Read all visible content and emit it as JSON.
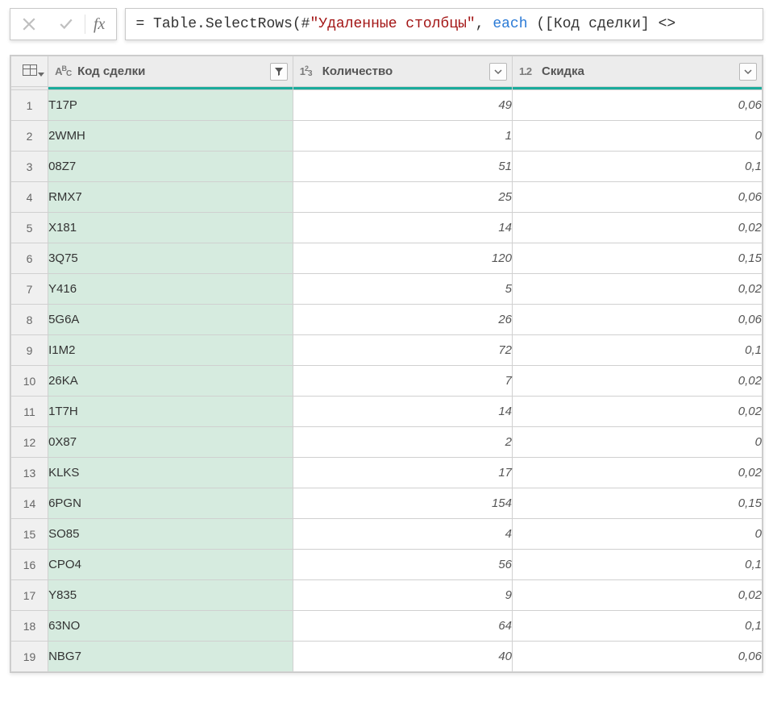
{
  "formula_bar": {
    "fx_label": "fx",
    "formula_prefix": "= Table.SelectRows(#",
    "formula_string": "\"Удаленные столбцы\"",
    "formula_mid": ", ",
    "formula_keyword": "each",
    "formula_suffix": " ([Код сделки] <> "
  },
  "columns": [
    {
      "type_label": "AᴮC",
      "label": "Код сделки",
      "filtered": true
    },
    {
      "type_label": "1²3",
      "label": "Количество",
      "filtered": false
    },
    {
      "type_label": "1.2",
      "label": "Скидка",
      "filtered": false
    }
  ],
  "rows": [
    {
      "n": "1",
      "code": "T17P",
      "qty": "49",
      "disc": "0,06"
    },
    {
      "n": "2",
      "code": "2WMH",
      "qty": "1",
      "disc": "0"
    },
    {
      "n": "3",
      "code": "08Z7",
      "qty": "51",
      "disc": "0,1"
    },
    {
      "n": "4",
      "code": "RMX7",
      "qty": "25",
      "disc": "0,06"
    },
    {
      "n": "5",
      "code": "X181",
      "qty": "14",
      "disc": "0,02"
    },
    {
      "n": "6",
      "code": "3Q75",
      "qty": "120",
      "disc": "0,15"
    },
    {
      "n": "7",
      "code": "Y416",
      "qty": "5",
      "disc": "0,02"
    },
    {
      "n": "8",
      "code": "5G6A",
      "qty": "26",
      "disc": "0,06"
    },
    {
      "n": "9",
      "code": "I1M2",
      "qty": "72",
      "disc": "0,1"
    },
    {
      "n": "10",
      "code": "26KA",
      "qty": "7",
      "disc": "0,02"
    },
    {
      "n": "11",
      "code": "1T7H",
      "qty": "14",
      "disc": "0,02"
    },
    {
      "n": "12",
      "code": "0X87",
      "qty": "2",
      "disc": "0"
    },
    {
      "n": "13",
      "code": "KLKS",
      "qty": "17",
      "disc": "0,02"
    },
    {
      "n": "14",
      "code": "6PGN",
      "qty": "154",
      "disc": "0,15"
    },
    {
      "n": "15",
      "code": "SO85",
      "qty": "4",
      "disc": "0"
    },
    {
      "n": "16",
      "code": "CPO4",
      "qty": "56",
      "disc": "0,1"
    },
    {
      "n": "17",
      "code": "Y835",
      "qty": "9",
      "disc": "0,02"
    },
    {
      "n": "18",
      "code": "63NO",
      "qty": "64",
      "disc": "0,1"
    },
    {
      "n": "19",
      "code": "NBG7",
      "qty": "40",
      "disc": "0,06"
    }
  ]
}
